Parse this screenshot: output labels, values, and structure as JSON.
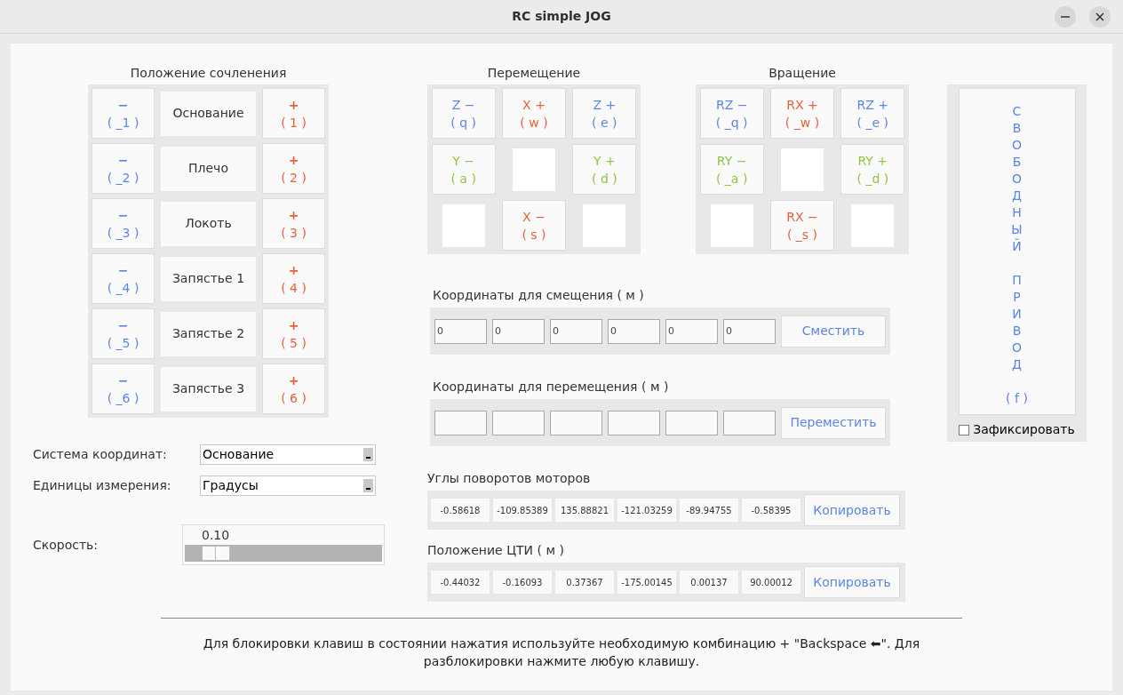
{
  "window": {
    "title": "RC simple JOG"
  },
  "joints": {
    "title": "Положение сочленения",
    "rows": [
      {
        "name": "Основание",
        "minus": {
          "sign": "−",
          "key": "( _1 )"
        },
        "plus": {
          "sign": "+",
          "key": "( 1 )"
        }
      },
      {
        "name": "Плечо",
        "minus": {
          "sign": "−",
          "key": "( _2 )"
        },
        "plus": {
          "sign": "+",
          "key": "( 2 )"
        }
      },
      {
        "name": "Локоть",
        "minus": {
          "sign": "−",
          "key": "( _3 )"
        },
        "plus": {
          "sign": "+",
          "key": "( 3 )"
        }
      },
      {
        "name": "Запястье 1",
        "minus": {
          "sign": "−",
          "key": "( _4 )"
        },
        "plus": {
          "sign": "+",
          "key": "( 4 )"
        }
      },
      {
        "name": "Запястье 2",
        "minus": {
          "sign": "−",
          "key": "( _5 )"
        },
        "plus": {
          "sign": "+",
          "key": "( 5 )"
        }
      },
      {
        "name": "Запястье 3",
        "minus": {
          "sign": "−",
          "key": "( _6 )"
        },
        "plus": {
          "sign": "+",
          "key": "( 6 )"
        }
      }
    ]
  },
  "jog_grids": [
    {
      "title": "Перемещение",
      "cells": [
        {
          "kind": "button",
          "label": "Z −",
          "key": "( q )",
          "color": "#5b86e5"
        },
        {
          "kind": "button",
          "label": "X +",
          "key": "( w )",
          "color": "#e8603c"
        },
        {
          "kind": "button",
          "label": "Z +",
          "key": "( e )",
          "color": "#5b86e5"
        },
        {
          "kind": "button",
          "label": "Y −",
          "key": "( a )",
          "color": "#8fc549"
        },
        {
          "kind": "empty"
        },
        {
          "kind": "button",
          "label": "Y +",
          "key": "( d )",
          "color": "#8fc549"
        },
        {
          "kind": "empty"
        },
        {
          "kind": "button",
          "label": "X −",
          "key": "( s )",
          "color": "#e8603c"
        },
        {
          "kind": "empty"
        }
      ]
    },
    {
      "title": "Вращение",
      "cells": [
        {
          "kind": "button",
          "label": "RZ −",
          "key": "( _q )",
          "color": "#5b86e5"
        },
        {
          "kind": "button",
          "label": "RX +",
          "key": "( _w )",
          "color": "#e8603c"
        },
        {
          "kind": "button",
          "label": "RZ +",
          "key": "( _e )",
          "color": "#5b86e5"
        },
        {
          "kind": "button",
          "label": "RY −",
          "key": "( _a )",
          "color": "#8fc549"
        },
        {
          "kind": "empty"
        },
        {
          "kind": "button",
          "label": "RY +",
          "key": "( _d )",
          "color": "#8fc549"
        },
        {
          "kind": "empty"
        },
        {
          "kind": "button",
          "label": "RX −",
          "key": "( _s )",
          "color": "#e8603c"
        },
        {
          "kind": "empty"
        }
      ]
    }
  ],
  "free_drive": {
    "lines": [
      "СВОБОДНЫЙ",
      "ПРИВОД"
    ],
    "key": "( f )",
    "lock": {
      "label": "Зафиксировать",
      "checked": false
    }
  },
  "settings": [
    {
      "label": "Система координат:",
      "value": "Основание"
    },
    {
      "label": "Единицы измерения:",
      "value": "Градусы"
    }
  ],
  "speed": {
    "label": "Скорость:",
    "reading": "0.10",
    "level": 0.1
  },
  "coord_inputs": [
    {
      "label": "Координаты для смещения ( м )",
      "fields": [
        {
          "kind": "input",
          "value": "0"
        },
        {
          "kind": "input",
          "value": "0"
        },
        {
          "kind": "input",
          "value": "0"
        },
        {
          "kind": "input",
          "value": "0"
        },
        {
          "kind": "input",
          "value": "0"
        },
        {
          "kind": "input",
          "value": "0"
        }
      ],
      "button": "Сместить"
    },
    {
      "label": "Координаты для перемещения ( м )",
      "fields": [
        {
          "kind": "input"
        },
        {
          "kind": "input"
        },
        {
          "kind": "input"
        },
        {
          "kind": "input"
        },
        {
          "kind": "input"
        },
        {
          "kind": "input"
        }
      ],
      "button": "Переместить"
    }
  ],
  "readouts": [
    {
      "label": "Углы поворотов моторов",
      "values": [
        "-0.58618",
        "-109.85389",
        "135.88821",
        "-121.03259",
        "-89.94755",
        "-0.58395"
      ],
      "button": "Копировать"
    },
    {
      "label": "Положение ЦТИ ( м )",
      "values": [
        "-0.44032",
        "-0.16093",
        "0.37367",
        "-175.00145",
        "0.00137",
        "90.00012"
      ],
      "button": "Копировать"
    }
  ],
  "footer": {
    "text": "Для блокировки клавиш в состоянии нажатия используйте необходимую комбинацию + \"Backspace ⬅\". Для разблокировки нажмите любую клавишу."
  }
}
